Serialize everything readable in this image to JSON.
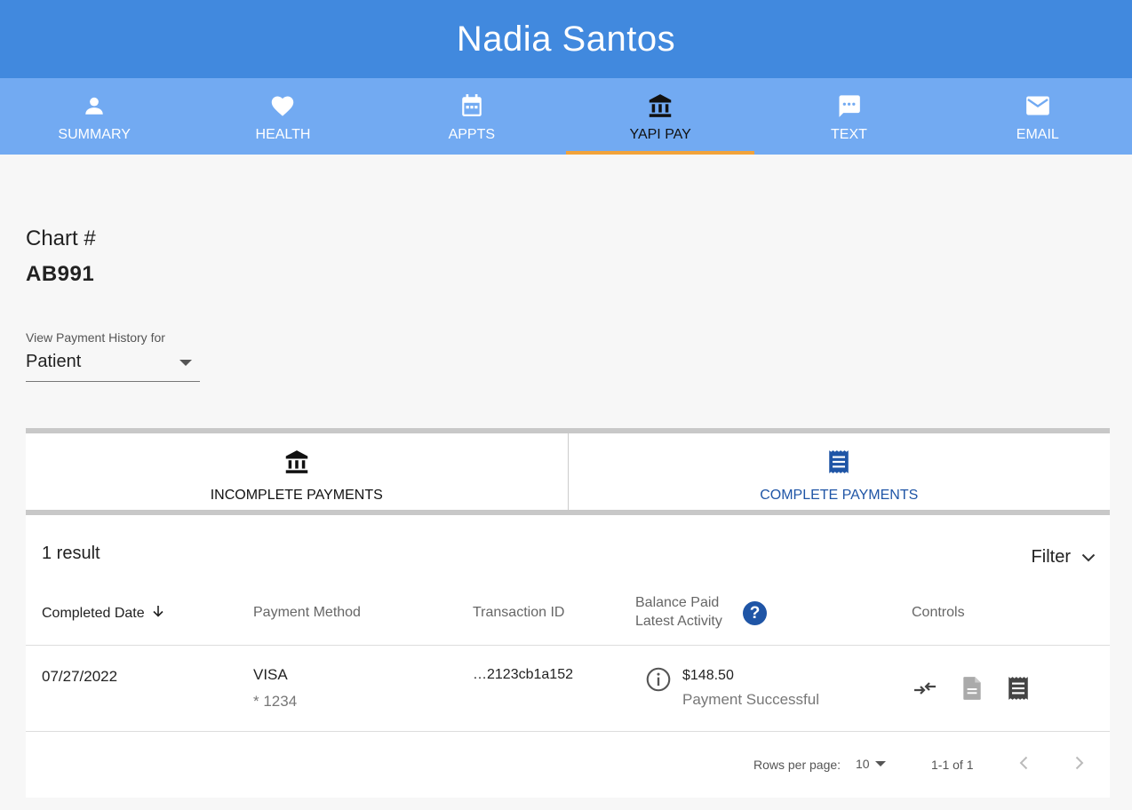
{
  "header": {
    "title": "Nadia Santos"
  },
  "nav": {
    "items": [
      {
        "label": "SUMMARY",
        "icon": "person-icon"
      },
      {
        "label": "HEALTH",
        "icon": "heart-icon"
      },
      {
        "label": "APPTS",
        "icon": "calendar-icon"
      },
      {
        "label": "YAPI PAY",
        "icon": "bank-icon",
        "active": true
      },
      {
        "label": "TEXT",
        "icon": "chat-icon"
      },
      {
        "label": "EMAIL",
        "icon": "mail-icon"
      }
    ]
  },
  "chart": {
    "label": "Chart #",
    "value": "AB991"
  },
  "history_select": {
    "label": "View Payment History for",
    "value": "Patient"
  },
  "payment_tabs": [
    {
      "label": "INCOMPLETE PAYMENTS",
      "icon": "bank-icon"
    },
    {
      "label": "COMPLETE PAYMENTS",
      "icon": "receipt-icon",
      "active": true
    }
  ],
  "results": {
    "count": "1 result",
    "filter_label": "Filter"
  },
  "table": {
    "headers": {
      "completed_date": "Completed Date",
      "payment_method": "Payment Method",
      "transaction_id": "Transaction ID",
      "balance_paid": "Balance Paid",
      "latest_activity": "Latest Activity",
      "controls": "Controls"
    },
    "rows": [
      {
        "date": "07/27/2022",
        "card_type": "VISA",
        "card_last4": "* 1234",
        "transaction_id": "…2123cb1a152",
        "amount": "$148.50",
        "status": "Payment Successful"
      }
    ]
  },
  "pagination": {
    "rows_per_page_label": "Rows per page:",
    "rows_per_page": "10",
    "range": "1-1 of 1"
  },
  "colors": {
    "header": "#4189de",
    "nav": "#72aaf2",
    "active_underline": "#f2a33a",
    "accent": "#1f55a6"
  }
}
